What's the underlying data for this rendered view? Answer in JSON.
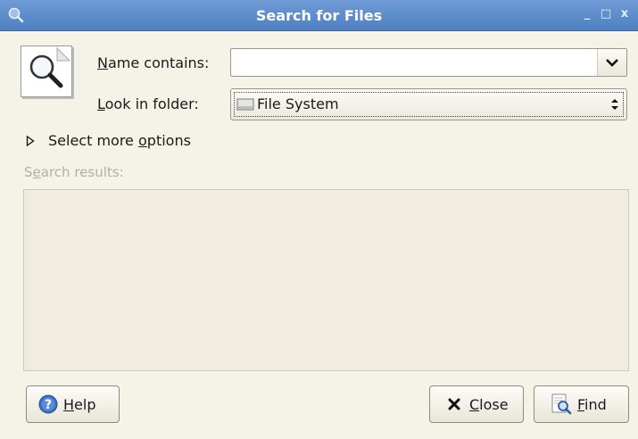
{
  "window": {
    "title": "Search for Files",
    "controls": {
      "minimize": "_",
      "maximize": "□",
      "close": "x"
    }
  },
  "form": {
    "name_label_mnemonic": "N",
    "name_label_rest": "ame contains:",
    "name_value": "",
    "folder_label_mnemonic": "L",
    "folder_label_rest": "ook in folder:",
    "folder_value": "File System"
  },
  "options": {
    "expander_before": "Select more ",
    "expander_mnemonic": "o",
    "expander_after": "ptions"
  },
  "results": {
    "label_before": "S",
    "label_mnemonic": "e",
    "label_after": "arch results:"
  },
  "buttons": {
    "help_mnemonic": "H",
    "help_rest": "elp",
    "close_mnemonic": "C",
    "close_rest": "lose",
    "find_mnemonic": "F",
    "find_rest": "ind"
  },
  "icons": {
    "titlebar": "search-icon",
    "dialog": "search-magnifier-icon",
    "folder": "drive-icon",
    "help": "help-icon",
    "close": "close-x-icon",
    "find": "find-icon"
  },
  "colors": {
    "titlebar": "#5a89c9",
    "window_bg": "#f5f2e8",
    "results_bg": "#f0ece0",
    "disabled_text": "#b3afa6"
  }
}
